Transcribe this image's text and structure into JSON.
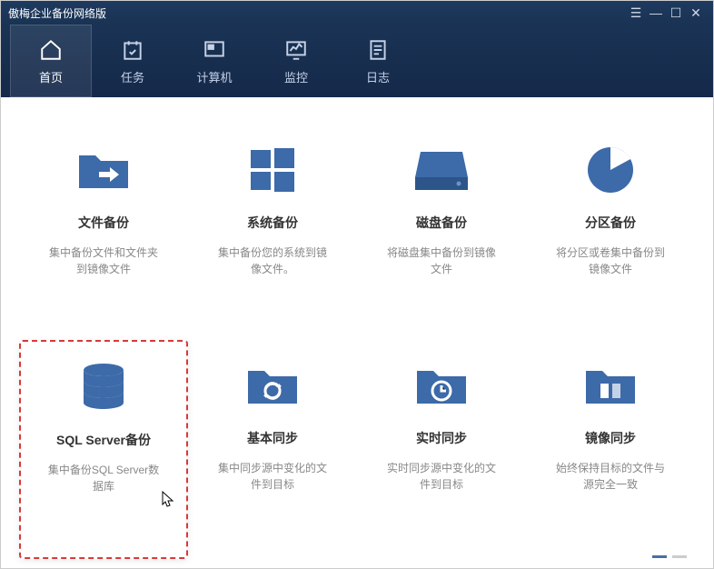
{
  "app": {
    "title": "傲梅企业备份网络版"
  },
  "nav": {
    "home": "首页",
    "tasks": "任务",
    "computers": "计算机",
    "monitor": "监控",
    "logs": "日志"
  },
  "cards": {
    "file_backup": {
      "title": "文件备份",
      "desc": "集中备份文件和文件夹到镜像文件"
    },
    "system_backup": {
      "title": "系统备份",
      "desc": "集中备份您的系统到镜像文件。"
    },
    "disk_backup": {
      "title": "磁盘备份",
      "desc": "将磁盘集中备份到镜像文件"
    },
    "partition_backup": {
      "title": "分区备份",
      "desc": "将分区或卷集中备份到镜像文件"
    },
    "sql_backup": {
      "title": "SQL Server备份",
      "desc": "集中备份SQL Server数据库"
    },
    "basic_sync": {
      "title": "基本同步",
      "desc": "集中同步源中变化的文件到目标"
    },
    "realtime_sync": {
      "title": "实时同步",
      "desc": "实时同步源中变化的文件到目标"
    },
    "mirror_sync": {
      "title": "镜像同步",
      "desc": "始终保持目标的文件与源完全一致"
    }
  },
  "colors": {
    "primary": "#3d6aa8",
    "accent": "#d93939"
  }
}
